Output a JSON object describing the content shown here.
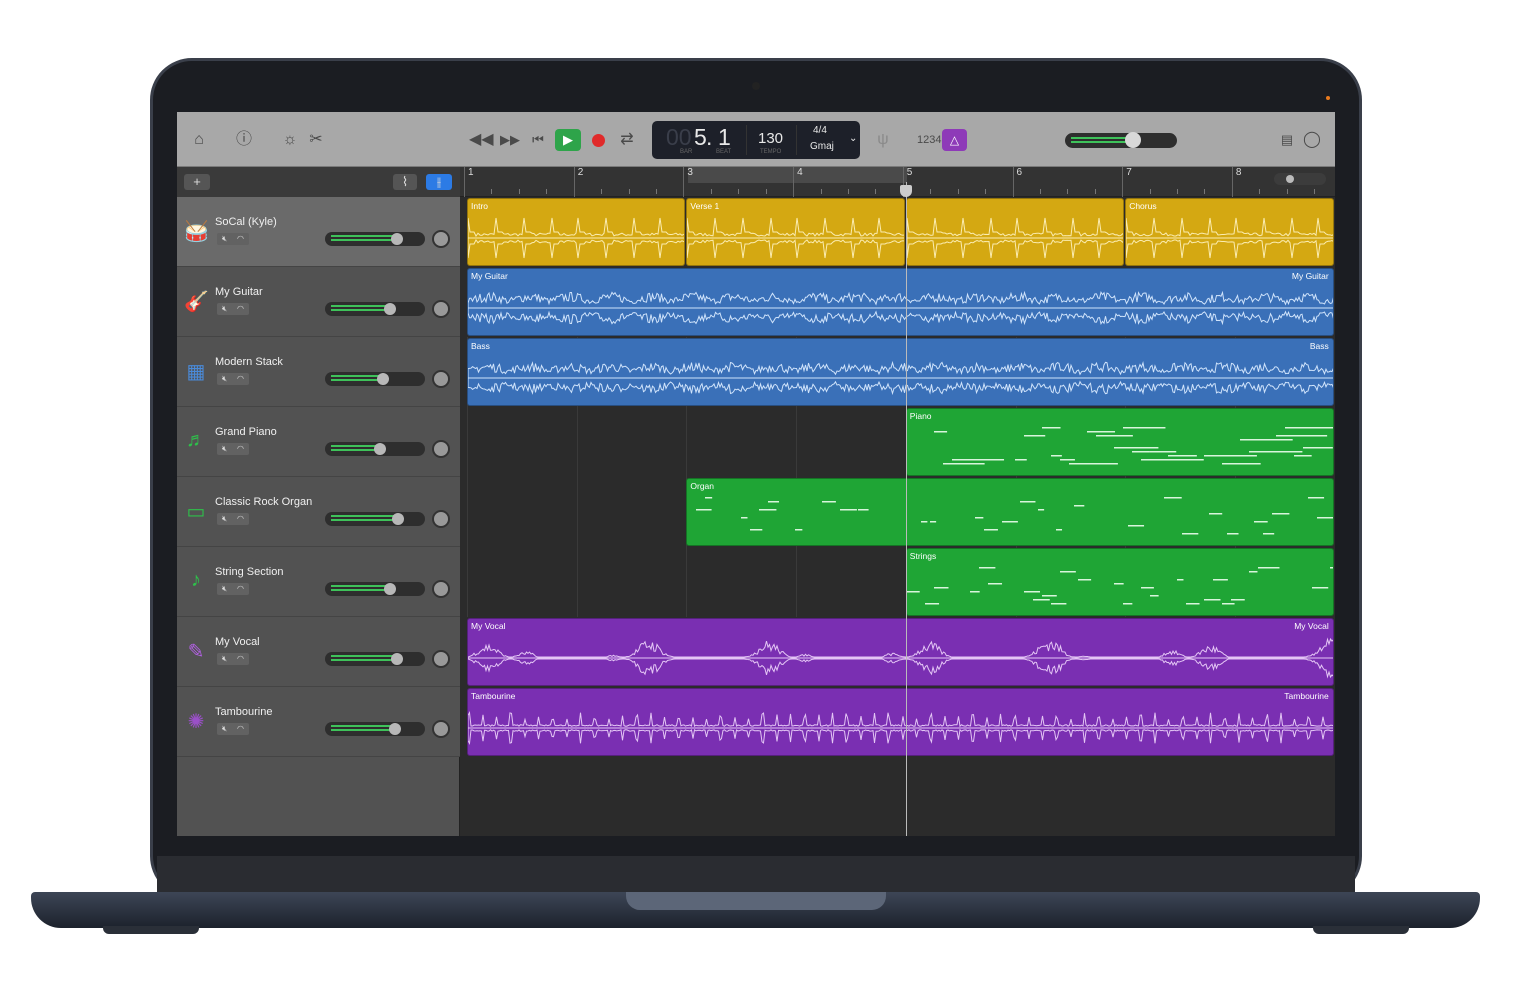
{
  "transport": {
    "bar": "5",
    "bar_prefix": "00",
    "beat": "1",
    "bar_label": "BAR",
    "beat_label": "BEAT",
    "tempo": "130",
    "tempo_label": "TEMPO",
    "time_signature": "4/4",
    "key": "Gmaj",
    "count_in": "1234"
  },
  "toolbar": {
    "icons": [
      "library-icon",
      "help-icon",
      "smart-controls-icon",
      "editors-icon",
      "rewind-icon",
      "fast-forward-icon",
      "go-to-beginning-icon",
      "play-icon",
      "record-icon",
      "cycle-icon",
      "tuner-icon",
      "count-in-icon",
      "metronome-icon",
      "list-editor-icon",
      "loop-browser-icon"
    ],
    "master_volume": 0.68
  },
  "header": {
    "add_label": "+"
  },
  "ruler": {
    "bars": [
      "1",
      "2",
      "3",
      "4",
      "5",
      "6",
      "7",
      "8"
    ]
  },
  "playhead_bar": 5,
  "colors": {
    "drums": "#d4a812",
    "audio_blue": "#3a70b8",
    "midi_green": "#1fa535",
    "vocal_purple": "#7a2fb2",
    "play_green": "#2ea44a",
    "record_red": "#e02a2a"
  },
  "tracks": [
    {
      "name": "SoCal (Kyle)",
      "icon": "drums-icon",
      "volume": 0.72,
      "color": "#d4a812",
      "kind": "drum",
      "regions": [
        {
          "label": "Intro",
          "start": 1,
          "end": 3
        },
        {
          "label": "Verse 1",
          "start": 3,
          "end": 5
        },
        {
          "label": "",
          "start": 5,
          "end": 7
        },
        {
          "label": "Chorus",
          "start": 7,
          "end": 8.91
        }
      ]
    },
    {
      "name": "My Guitar",
      "icon": "guitar-icon",
      "volume": 0.65,
      "color": "#3a70b8",
      "kind": "audio",
      "regions": [
        {
          "label": "My Guitar",
          "label_right": "My Guitar",
          "start": 1,
          "end": 8.91
        }
      ]
    },
    {
      "name": "Modern Stack",
      "icon": "amp-icon",
      "volume": 0.58,
      "color": "#3a70b8",
      "kind": "audio",
      "regions": [
        {
          "label": "Bass",
          "label_right": "Bass",
          "start": 1,
          "end": 8.91
        }
      ]
    },
    {
      "name": "Grand Piano",
      "icon": "piano-icon",
      "volume": 0.55,
      "color": "#1fa535",
      "kind": "midi",
      "regions": [
        {
          "label": "Piano",
          "start": 5,
          "end": 8.91
        }
      ]
    },
    {
      "name": "Classic Rock Organ",
      "icon": "organ-icon",
      "volume": 0.73,
      "color": "#1fa535",
      "kind": "midi",
      "regions": [
        {
          "label": "Organ",
          "start": 3,
          "end": 8.91
        }
      ]
    },
    {
      "name": "String Section",
      "icon": "strings-icon",
      "volume": 0.65,
      "color": "#1fa535",
      "kind": "midi",
      "regions": [
        {
          "label": "Strings",
          "start": 5,
          "end": 8.91
        }
      ]
    },
    {
      "name": "My Vocal",
      "icon": "microphone-icon",
      "volume": 0.72,
      "color": "#7a2fb2",
      "kind": "vocal",
      "regions": [
        {
          "label": "My Vocal",
          "label_right": "My Vocal",
          "start": 1,
          "end": 8.91
        }
      ]
    },
    {
      "name": "Tambourine",
      "icon": "tambourine-icon",
      "volume": 0.7,
      "color": "#7a2fb2",
      "kind": "tamb",
      "regions": [
        {
          "label": "Tambourine",
          "label_right": "Tambourine",
          "start": 1,
          "end": 8.91
        }
      ]
    }
  ]
}
